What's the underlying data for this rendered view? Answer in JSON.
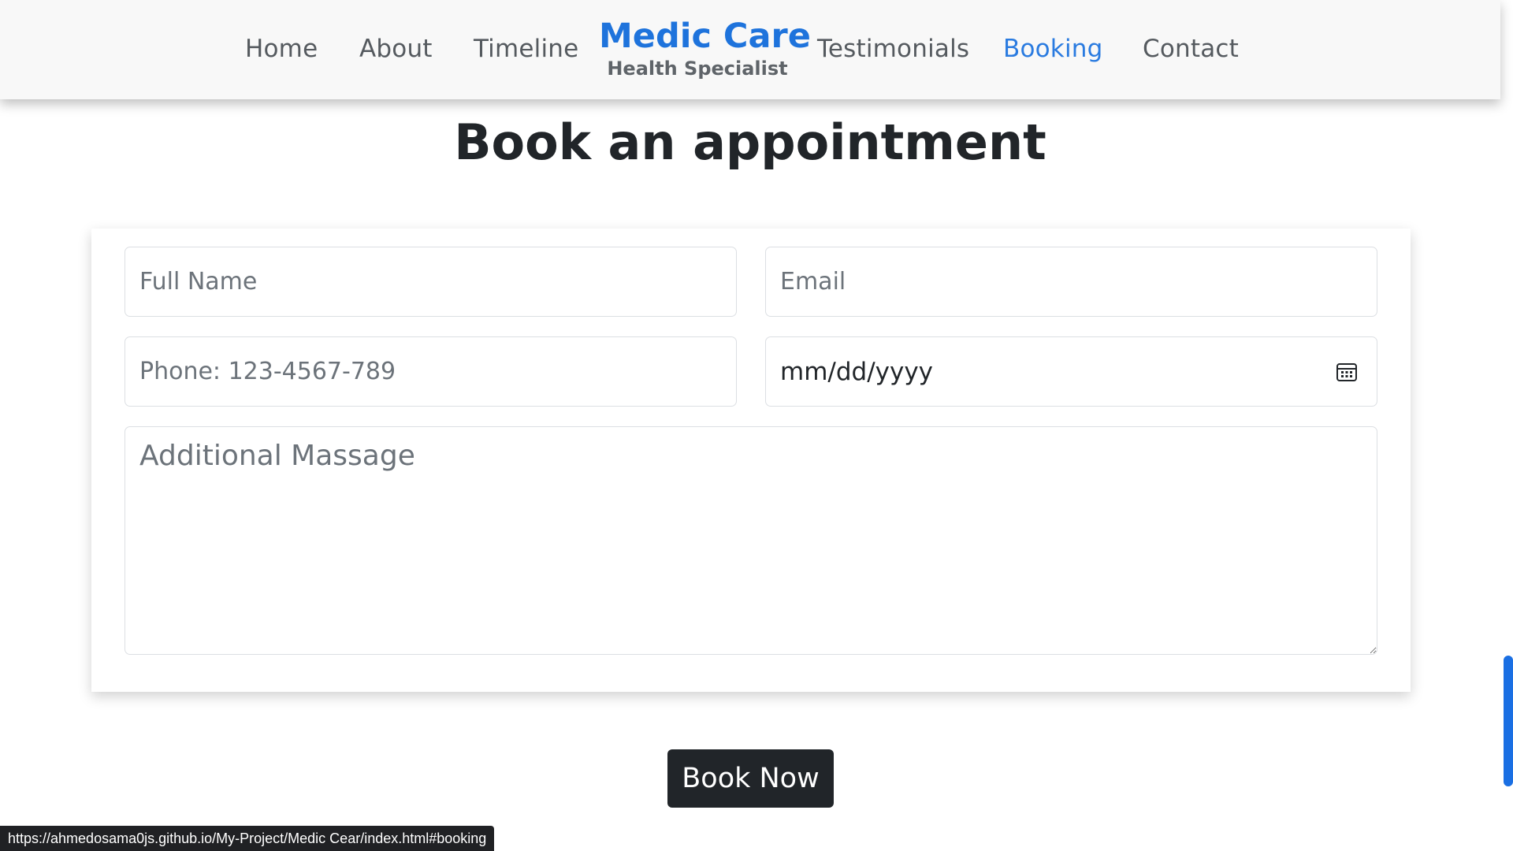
{
  "nav": {
    "links": [
      "Home",
      "About",
      "Timeline",
      "Testimonials",
      "Booking",
      "Contact"
    ],
    "active": "Booking",
    "brand_title": "Medic Care",
    "brand_subtitle": "Health Specialist"
  },
  "booking": {
    "title": "Book an appointment",
    "fullname_placeholder": "Full Name",
    "email_placeholder": "Email",
    "phone_placeholder": "Phone: 123-4567-789",
    "date_value": "mm/dd/yyyy",
    "date_icon": "calendar-icon",
    "message_placeholder": "Additional Massage",
    "submit_label": "Book Now"
  },
  "status_bar": {
    "url": "https://ahmedosama0js.github.io/My-Project/Medic Cear/index.html#booking"
  },
  "colors": {
    "accent": "#1e73dc",
    "active_link": "#2a7be0",
    "button_bg": "#212529",
    "scroll_thumb": "#1a6fe3"
  }
}
